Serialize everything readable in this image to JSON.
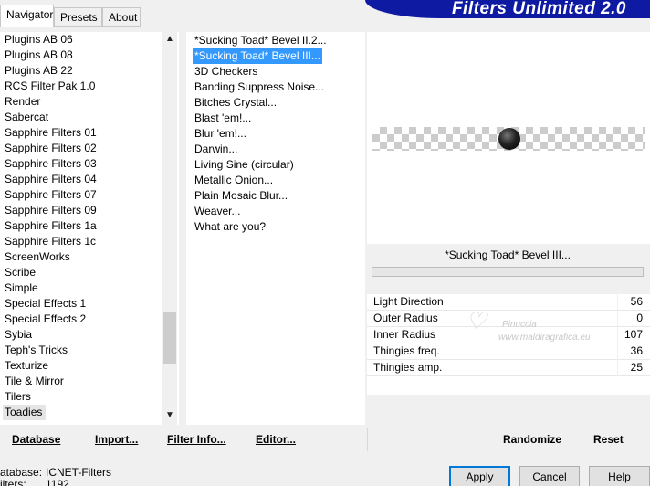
{
  "tabs": [
    {
      "label": "Navigator",
      "active": true
    },
    {
      "label": "Presets",
      "active": false
    },
    {
      "label": "About",
      "active": false
    }
  ],
  "banner": {
    "title": "Filters Unlimited 2.0",
    "color": "#0f1aa3"
  },
  "categories": {
    "items": [
      "Plugins AB 06",
      "Plugins AB 08",
      "Plugins AB 22",
      "RCS Filter Pak 1.0",
      "Render",
      "Sabercat",
      "Sapphire Filters 01",
      "Sapphire Filters 02",
      "Sapphire Filters 03",
      "Sapphire Filters 04",
      "Sapphire Filters 07",
      "Sapphire Filters 09",
      "Sapphire Filters 1a",
      "Sapphire Filters 1c",
      "ScreenWorks",
      "Scribe",
      "Simple",
      "Special Effects 1",
      "Special Effects 2",
      "Sybia",
      "Teph's Tricks",
      "Texturize",
      "Tile & Mirror",
      "Tilers",
      "Toadies"
    ],
    "selected": "Toadies"
  },
  "filters": {
    "items": [
      "*Sucking Toad*  Bevel II.2...",
      "*Sucking Toad*  Bevel III...",
      "3D Checkers",
      "Banding Suppress Noise...",
      "Bitches Crystal...",
      "Blast 'em!...",
      "Blur 'em!...",
      "Darwin...",
      "Living Sine (circular)",
      "Metallic Onion...",
      "Plain Mosaic Blur...",
      "Weaver...",
      "What are you?"
    ],
    "selected": "*Sucking Toad*  Bevel III...",
    "selection_color": "#3399ff"
  },
  "preview": {
    "filter_name": "*Sucking Toad*  Bevel III..."
  },
  "params": [
    {
      "label": "Light Direction",
      "value": "56"
    },
    {
      "label": "Outer Radius",
      "value": "0"
    },
    {
      "label": "Inner Radius",
      "value": "107"
    },
    {
      "label": "Thingies freq.",
      "value": "36"
    },
    {
      "label": "Thingies amp.",
      "value": "25"
    }
  ],
  "watermark": {
    "line1": "Pinuccia",
    "line2": "www.maldiragrafica.eu"
  },
  "toolbar": {
    "database": "Database",
    "import": "Import...",
    "filter_info": "Filter Info...",
    "editor": "Editor...",
    "randomize": "Randomize",
    "reset": "Reset"
  },
  "footer": {
    "database_label": "atabase:",
    "database_value": "ICNET-Filters",
    "filters_label": "ilters:",
    "filters_value": "1192"
  },
  "buttons": {
    "apply": "Apply",
    "cancel": "Cancel",
    "help": "Help"
  }
}
